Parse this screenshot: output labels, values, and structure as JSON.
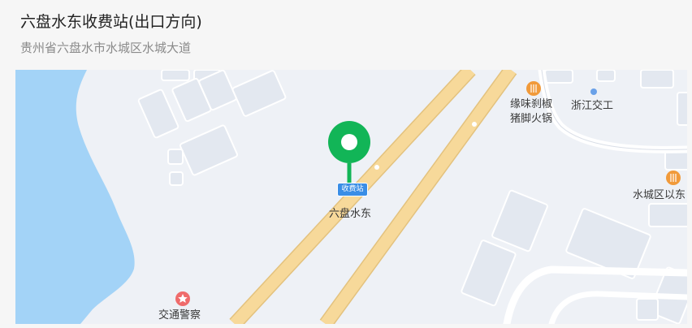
{
  "header": {
    "title": "六盘水东收费站(出口方向)",
    "address": "贵州省六盘水市水城区水城大道"
  },
  "map": {
    "marker": {
      "badge": "收费站",
      "label": "六盘水东",
      "color": "#12b557"
    },
    "pois": [
      {
        "line1": "缘味刹椒",
        "line2": "猪脚火锅",
        "icon": "restaurant-icon"
      },
      {
        "line1": "浙江交工",
        "icon": "dot-icon"
      },
      {
        "line1": "水城区以东",
        "icon": "restaurant-icon"
      },
      {
        "line1": "交通警察",
        "icon": "police-icon"
      }
    ],
    "colors": {
      "water": "#a3d3f7",
      "road": "#f7d99a",
      "land": "#eef1f6",
      "building": "#e2e7ef"
    }
  }
}
